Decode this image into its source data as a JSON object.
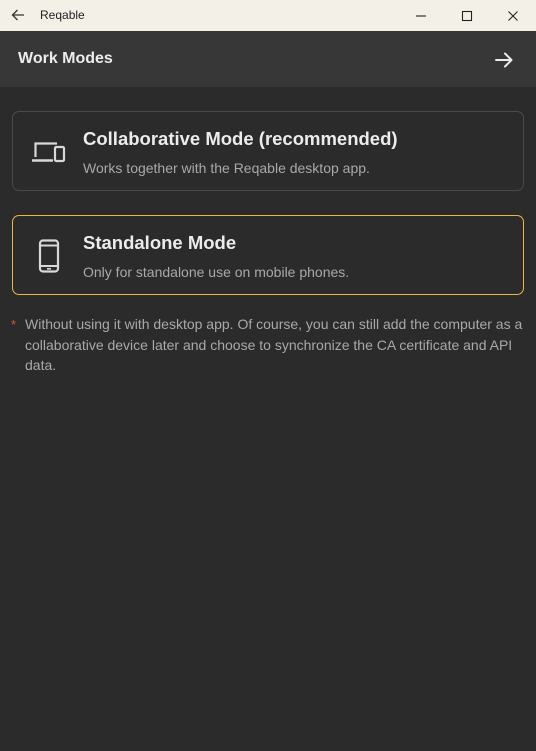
{
  "window": {
    "title": "Reqable",
    "back_icon": "arrow-left-icon",
    "controls": [
      "minimize-icon",
      "maximize-icon",
      "close-icon"
    ]
  },
  "appbar": {
    "title": "Work Modes",
    "next_icon": "arrow-right-icon"
  },
  "modes": [
    {
      "title": "Collaborative Mode (recommended)",
      "description": "Works together with the Reqable desktop app.",
      "icon": "devices-icon",
      "selected": false
    },
    {
      "title": "Standalone Mode",
      "description": "Only for standalone use on mobile phones.",
      "icon": "phone-icon",
      "selected": true
    }
  ],
  "note": {
    "marker": "*",
    "text": "Without using it with desktop app. Of course, you can still add the computer as a collaborative device later and choose to synchronize the CA certificate and API data."
  },
  "colors": {
    "background": "#2b2b2b",
    "appbar": "#373737",
    "titlebar": "#f3f0e8",
    "selected_border": "#f0b545",
    "card_border": "#4a4a4a",
    "note_marker": "#d9533b"
  }
}
